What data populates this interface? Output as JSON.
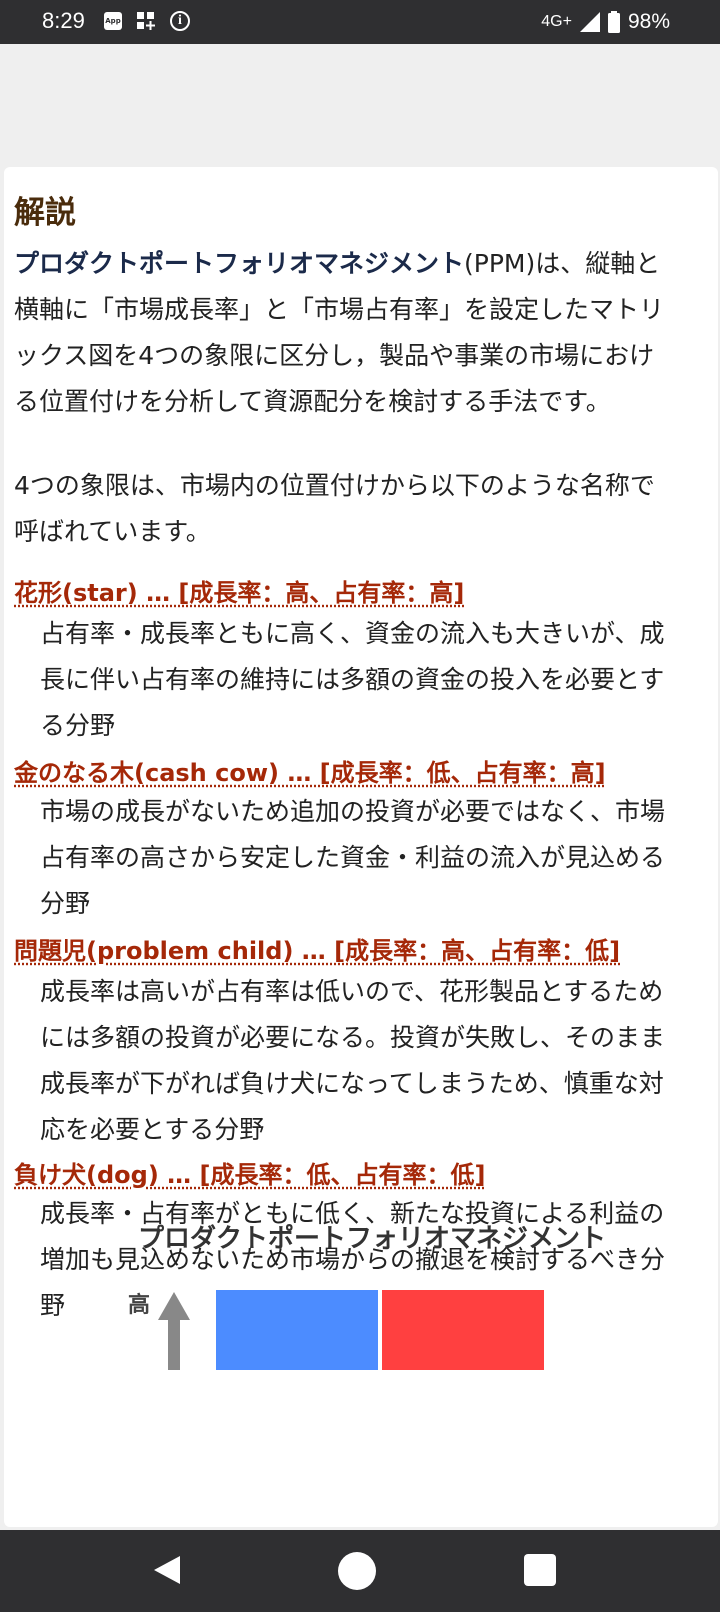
{
  "status_bar": {
    "time": "8:29",
    "app_icon_text": "App",
    "network": "4G+",
    "battery": "98%"
  },
  "card": {
    "title": "解説",
    "intro_lines": [
      [
        "プロダクトポートフォリオマネジメント",
        "(PPM)は、縦軸と"
      ],
      [
        "横軸に「市場成長率」と「市場占有率」を設定したマトリ"
      ],
      [
        "ックス図を4つの象限に区分し，製品や事業の市場におけ"
      ],
      [
        "る位置付けを分析して資源配分を検討する手法です。"
      ]
    ],
    "quadrant_intro_lines": [
      "4つの象限は、市場内の位置付けから以下のような名称で",
      "呼ばれています。"
    ],
    "items": [
      {
        "heading": "花形(star) … [成長率：高、占有率：高]",
        "lines": [
          "占有率・成長率ともに高く、資金の流入も大きいが、成",
          "長に伴い占有率の維持には多額の資金の投入を必要とす",
          "る分野"
        ]
      },
      {
        "heading": "金のなる木(cash cow) … [成長率：低、占有率：高]",
        "lines": [
          "市場の成長がないため追加の投資が必要ではなく、市場",
          "占有率の高さから安定した資金・利益の流入が見込める",
          "分野"
        ]
      },
      {
        "heading": "問題児(problem child) … [成長率：高、占有率：低]",
        "lines": [
          "成長率は高いが占有率は低いので、花形製品とするため",
          "には多額の投資が必要になる。投資が失敗し、そのまま",
          "成長率が下がれば負け犬になってしまうため、慎重な対",
          "応を必要とする分野"
        ]
      },
      {
        "heading": "負け犬(dog) … [成長率：低、占有率：低]",
        "lines": [
          "成長率・占有率がともに低く、新たな投資による利益の",
          "増加も見込めないため市場からの撤退を検討するべき分",
          "野"
        ]
      }
    ],
    "figure": {
      "title": "プロダクトポートフォリオマネジメント",
      "axis_label": "高",
      "colors": {
        "top_left": "#4c8cff",
        "top_right": "#ff4040"
      }
    }
  },
  "nav": {
    "back_icon": "triangle-back",
    "home_icon": "circle-home",
    "recent_icon": "square-recents"
  }
}
